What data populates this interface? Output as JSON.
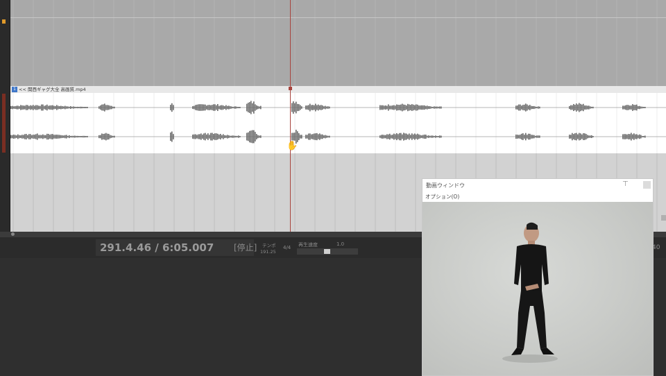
{
  "clip": {
    "number": "1",
    "title": "<< 関西ギャグ大全 高画質.mp4"
  },
  "transport": {
    "position": "291.4.46 / 6:05.007",
    "state": "[停止]",
    "tempo_label": "テンポ",
    "tempo_value": "191.25",
    "time_signature": "4/4",
    "speed_label": "再生速度",
    "speed_value": "1.0",
    "right_digits": "40"
  },
  "video_window": {
    "title": "動画ウィンドウ",
    "menu_option": "オプション(O)",
    "pin_icon": "pin-icon"
  },
  "colors": {
    "playhead": "#a8443d",
    "clip_badge": "#3f77c9",
    "marker": "#e09a2a"
  }
}
